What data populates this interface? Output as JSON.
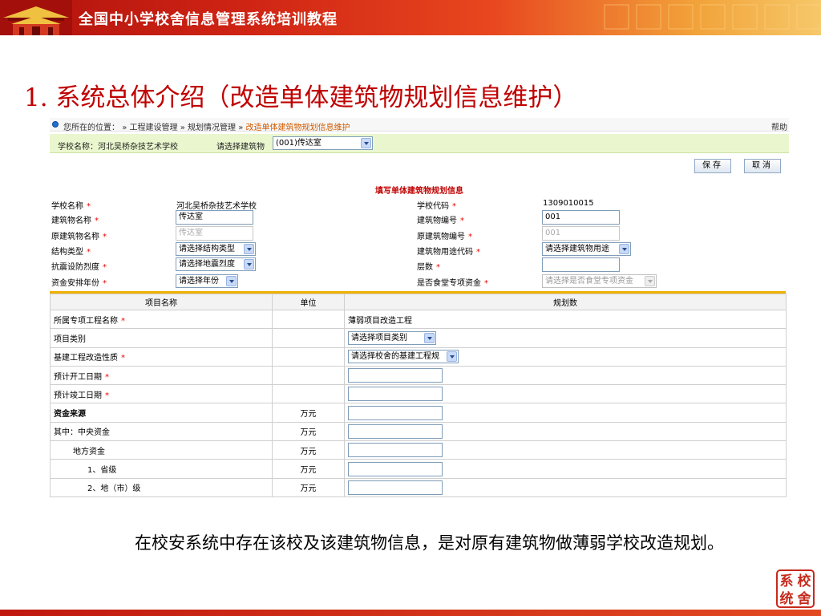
{
  "slide": {
    "banner_title": "全国中小学校舍信息管理系统培训教程",
    "title": "1. 系统总体介绍（改造单体建筑物规划信息维护）",
    "note": "在校安系统中存在该校及该建筑物信息，是对原有建筑物做薄弱学校改造规划。",
    "stamp_text": [
      "系",
      "校",
      "统",
      "舍"
    ]
  },
  "app": {
    "breadcrumb": {
      "prefix": "您所在的位置：",
      "items": [
        "工程建设管理",
        "规划情况管理"
      ],
      "current": "改造单体建筑物规划信息维护",
      "separator": "»",
      "help": "帮助"
    },
    "school_bar": {
      "school_label": "学校名称：",
      "school_name": "河北吴桥杂技艺术学校",
      "building_label": "请选择建筑物",
      "building_value": "(001)传达室"
    },
    "buttons": {
      "save": "保存",
      "cancel": "取消"
    },
    "form": {
      "heading": "填写单体建筑物规划信息",
      "school_name_label": "学校名称",
      "school_name_value": "河北吴桥杂技艺术学校",
      "school_code_label": "学校代码",
      "school_code_value": "1309010015",
      "building_name_label": "建筑物名称",
      "building_name_value": "传达室",
      "building_no_label": "建筑物编号",
      "building_no_value": "001",
      "orig_building_name_label": "原建筑物名称",
      "orig_building_name_value": "传达室",
      "orig_building_no_label": "原建筑物编号",
      "orig_building_no_value": "001",
      "structure_label": "结构类型",
      "structure_value": "请选择结构类型",
      "usage_label": "建筑物用途代码",
      "usage_value": "请选择建筑物用途",
      "seismic_label": "抗震设防烈度",
      "seismic_value": "请选择地震烈度",
      "floors_label": "层数",
      "floors_value": "",
      "year_label": "资金安排年份",
      "year_value": "请选择年份",
      "canteen_label": "是否食堂专项资金",
      "canteen_value": "请选择是否食堂专项资金",
      "required_mark": "*"
    },
    "table": {
      "headers": [
        "项目名称",
        "单位",
        "规划数"
      ],
      "rows": [
        {
          "name": "所属专项工程名称",
          "required": "*",
          "unit": "",
          "value": "薄弱项目改造工程",
          "kind": "text"
        },
        {
          "name": "项目类别",
          "required": "",
          "unit": "",
          "value": "请选择项目类别",
          "kind": "select"
        },
        {
          "name": "基建工程改造性质",
          "required": "*",
          "unit": "",
          "value": "请选择校舍的基建工程规",
          "kind": "select"
        },
        {
          "name": "预计开工日期",
          "required": "*",
          "unit": "",
          "value": "",
          "kind": "input"
        },
        {
          "name": "预计竣工日期",
          "required": "*",
          "unit": "",
          "value": "",
          "kind": "input"
        },
        {
          "name": "资金来源",
          "required": "",
          "unit": "万元",
          "value": "",
          "kind": "input",
          "bold": true
        },
        {
          "name": "其中：中央资金",
          "required": "",
          "unit": "万元",
          "value": "",
          "kind": "input"
        },
        {
          "name": "地方资金",
          "required": "",
          "unit": "万元",
          "value": "",
          "kind": "input",
          "indent": 1
        },
        {
          "name": "1、省级",
          "required": "",
          "unit": "万元",
          "value": "",
          "kind": "input",
          "indent": 2
        },
        {
          "name": "2、地（市）级",
          "required": "",
          "unit": "万元",
          "value": "",
          "kind": "input",
          "indent": 2
        }
      ]
    }
  }
}
